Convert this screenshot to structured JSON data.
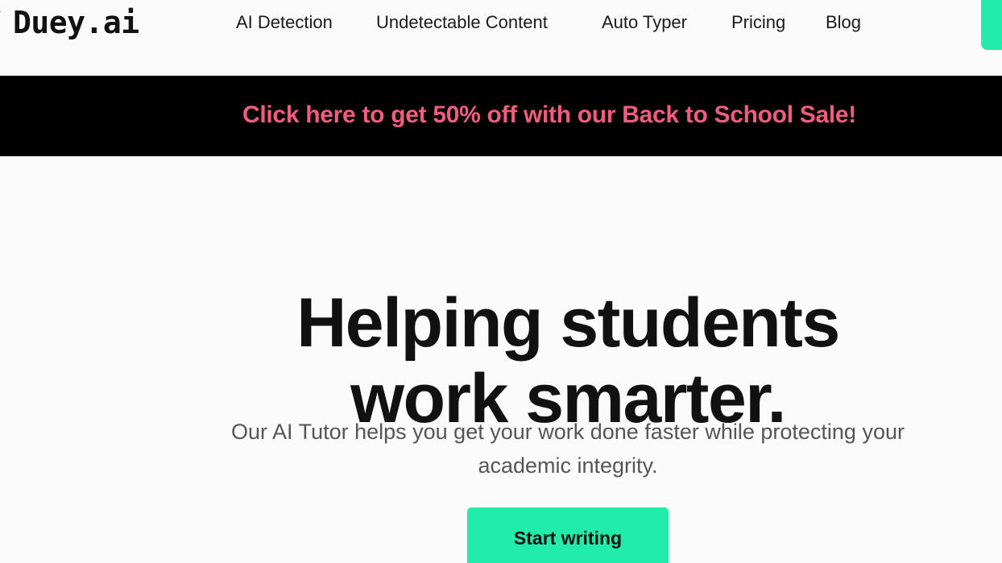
{
  "header": {
    "logo_text": "Duey.ai",
    "nav": [
      {
        "label": "AI Detection"
      },
      {
        "label": "Undetectable Content"
      },
      {
        "label": "Auto Typer"
      },
      {
        "label": "Pricing"
      },
      {
        "label": "Blog"
      }
    ]
  },
  "banner": {
    "text": "Click here to get 50% off with our Back to School Sale!"
  },
  "hero": {
    "title": "Helping students work smarter.",
    "subtitle": "Our AI Tutor helps you get your work done faster while protecting your academic integrity.",
    "cta_label": "Start writing"
  },
  "colors": {
    "accent": "#22ecaa",
    "banner_bg": "#000000",
    "banner_text": "#f25c7f",
    "page_bg": "#fbfbfb"
  }
}
